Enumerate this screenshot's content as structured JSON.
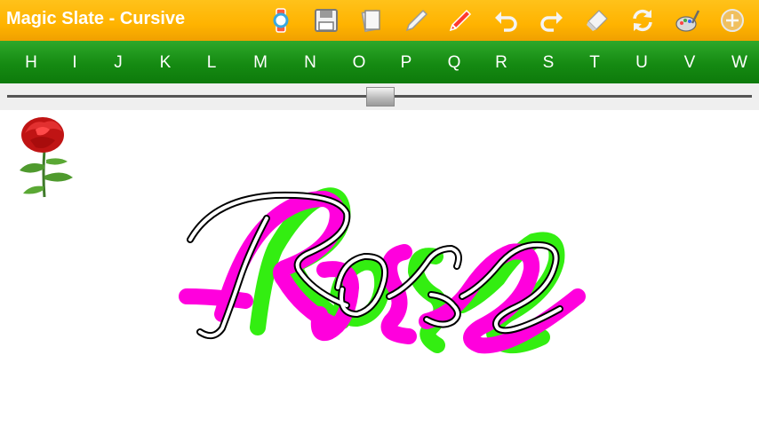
{
  "app": {
    "title": "Magic Slate - Cursive"
  },
  "toolbar": {
    "tools": [
      {
        "name": "watch-icon",
        "color": "#3aa8e0"
      },
      {
        "name": "save-icon"
      },
      {
        "name": "page-icon"
      },
      {
        "name": "pencil-icon"
      },
      {
        "name": "marker-icon",
        "color": "#ff3b2f"
      },
      {
        "name": "undo-icon"
      },
      {
        "name": "redo-icon"
      },
      {
        "name": "eraser-icon"
      },
      {
        "name": "refresh-icon"
      },
      {
        "name": "palette-icon"
      },
      {
        "name": "add-icon"
      }
    ]
  },
  "letters": [
    "H",
    "I",
    "J",
    "K",
    "L",
    "M",
    "N",
    "O",
    "P",
    "Q",
    "R",
    "S",
    "T",
    "U",
    "V",
    "W"
  ],
  "slider": {
    "value": 0.5
  },
  "drawing": {
    "word": "Rose",
    "colors": {
      "green": "#33ee11",
      "magenta": "#ff00dd",
      "outline": "#000000"
    }
  },
  "theme": {
    "toolbar": "#ffb300",
    "letterbar": "#1a8f16"
  }
}
